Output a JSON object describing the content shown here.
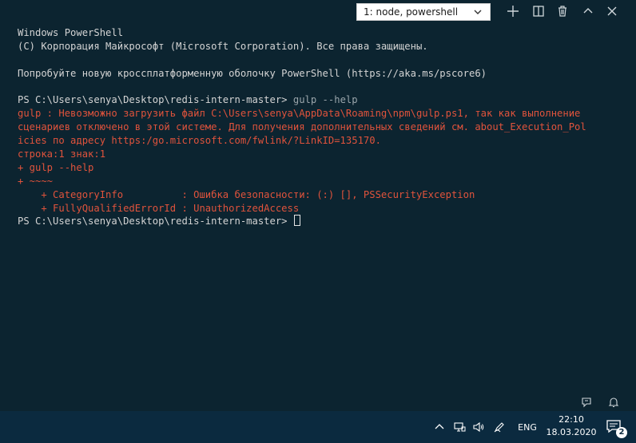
{
  "toolbar": {
    "shell_selected": "1: node, powershell",
    "icons": [
      "plus-icon",
      "split-icon",
      "trash-icon",
      "chevron-up-icon",
      "close-icon"
    ]
  },
  "terminal": {
    "lines": [
      {
        "text": "Windows PowerShell",
        "style": "normal"
      },
      {
        "text": "(C) Корпорация Майкрософт (Microsoft Corporation). Все права защищены.",
        "style": "normal"
      },
      {
        "text": "",
        "style": "blank"
      },
      {
        "text": "Попробуйте новую кроссплатформенную оболочку PowerShell (https://aka.ms/pscore6)",
        "style": "normal"
      },
      {
        "text": "",
        "style": "blank"
      },
      {
        "text": "PS C:\\Users\\senya\\Desktop\\redis-intern-master> ",
        "style": "prompt",
        "cmd": "gulp --help"
      },
      {
        "text": "gulp : Невозможно загрузить файл C:\\Users\\senya\\AppData\\Roaming\\npm\\gulp.ps1, так как выполнение",
        "style": "error"
      },
      {
        "text": "сценариев отключено в этой системе. Для получения дополнительных сведений см. about_Execution_Pol",
        "style": "error"
      },
      {
        "text": "icies по адресу https:/go.microsoft.com/fwlink/?LinkID=135170.",
        "style": "error"
      },
      {
        "text": "строка:1 знак:1",
        "style": "error"
      },
      {
        "text": "+ gulp --help",
        "style": "error"
      },
      {
        "text": "+ ~~~~",
        "style": "error"
      },
      {
        "text": "    + CategoryInfo          : Ошибка безопасности: (:) [], PSSecurityException",
        "style": "error"
      },
      {
        "text": "    + FullyQualifiedErrorId : UnauthorizedAccess",
        "style": "error"
      },
      {
        "text": "PS C:\\Users\\senya\\Desktop\\redis-intern-master> ",
        "style": "prompt-cursor"
      }
    ]
  },
  "panel_status": {
    "icons": [
      "feedback-icon",
      "bell-icon"
    ]
  },
  "taskbar": {
    "lang": "ENG",
    "time": "22:10",
    "date": "18.03.2020",
    "notification_count": "2",
    "tray_icons": [
      "chevron-up-icon",
      "network-icon",
      "volume-icon",
      "pen-icon"
    ]
  },
  "colors": {
    "background": "#0c2430",
    "text": "#d4d4d4",
    "error": "#e0533c",
    "taskbar": "#0b2a3f"
  }
}
